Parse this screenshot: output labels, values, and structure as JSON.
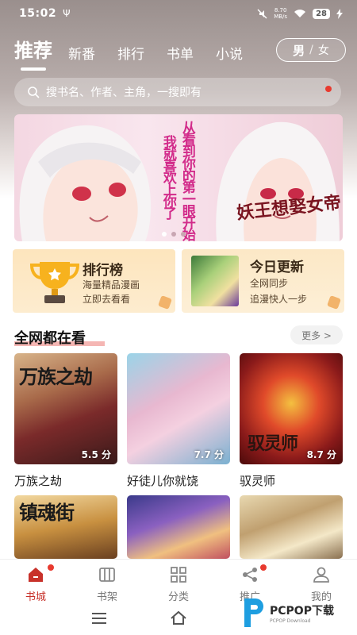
{
  "status_bar": {
    "time": "15:02",
    "net_speed_value": "8.70",
    "net_speed_unit": "MB/s",
    "battery": "28"
  },
  "tabs": [
    {
      "label": "推荐",
      "active": true
    },
    {
      "label": "新番",
      "active": false
    },
    {
      "label": "排行",
      "active": false
    },
    {
      "label": "书单",
      "active": false
    },
    {
      "label": "小说",
      "active": false
    }
  ],
  "gender_toggle": {
    "male": "男",
    "separator": "/",
    "female": "女"
  },
  "search": {
    "placeholder": "搜书名、作者、主角，一搜即有"
  },
  "banner": {
    "text_lines": [
      "从看到你的第一眼开始",
      "我就喜欢上你了"
    ],
    "logo_text": "妖王想娶女帝",
    "accent_color": "#d22b8a"
  },
  "promo_cards": {
    "ranking": {
      "title": "排行榜",
      "line1": "海量精品漫画",
      "line2": "立即去看看"
    },
    "update": {
      "title": "今日更新",
      "line1": "全网同步",
      "line2": "追漫快人一步"
    }
  },
  "section": {
    "title": "全网都在看",
    "more": "更多 >"
  },
  "comics": [
    {
      "title": "万族之劫",
      "score": "5.5 分",
      "cover_text": "万族之劫"
    },
    {
      "title": "好徒儿你就饶",
      "score": "7.7 分",
      "cover_text": ""
    },
    {
      "title": "驭灵师",
      "score": "8.7 分",
      "cover_text": "驭灵师"
    },
    {
      "title": "",
      "score": "",
      "cover_text": "镇魂街"
    },
    {
      "title": "",
      "score": "",
      "cover_text": ""
    },
    {
      "title": "",
      "score": "",
      "cover_text": ""
    }
  ],
  "bottom_nav": [
    {
      "label": "书城",
      "icon": "home-icon",
      "active": true,
      "dot": true
    },
    {
      "label": "书架",
      "icon": "bookshelf-icon",
      "active": false,
      "dot": false
    },
    {
      "label": "分类",
      "icon": "grid-icon",
      "active": false,
      "dot": false
    },
    {
      "label": "推广",
      "icon": "share-icon",
      "active": false,
      "dot": true
    },
    {
      "label": "我的",
      "icon": "user-icon",
      "active": false,
      "dot": false
    }
  ],
  "watermark": {
    "brand": "PCPOP下载",
    "sub": "PCPOP Download"
  },
  "colors": {
    "accent": "#c8312a",
    "badge": "#e83a2f"
  }
}
